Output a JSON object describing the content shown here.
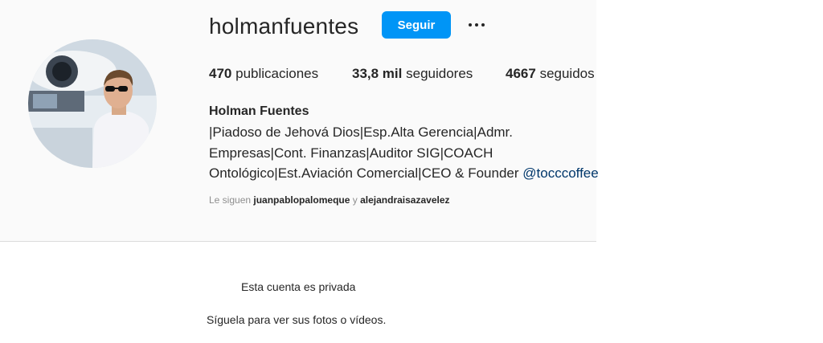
{
  "profile": {
    "username": "holmanfuentes",
    "follow_label": "Seguir",
    "more_icon": "more-horizontal-icon",
    "full_name": "Holman Fuentes",
    "bio_lines": [
      "|Piadoso de Jehová Dios|Esp.Alta Gerencia|Admr.",
      "Empresas|Cont. Finanzas|Auditor SIG|COACH",
      "Ontológico|Est.Aviación Comercial|CEO & Founder"
    ],
    "bio_mention": "@tocccoffee"
  },
  "stats": {
    "posts_count": "470",
    "posts_label": "publicaciones",
    "followers_count": "33,8 mil",
    "followers_label": "seguidores",
    "following_count": "4667",
    "following_label": "seguidos"
  },
  "followed_by": {
    "prefix": "Le siguen",
    "user1": "juanpablopalomeque",
    "conjunction": "y",
    "user2": "alejandraisazavelez"
  },
  "private_notice": {
    "title": "Esta cuenta es privada",
    "subtitle": "Síguela para ver sus fotos o vídeos."
  },
  "colors": {
    "accent": "#0095f6",
    "mention": "#00376b",
    "header_bg": "#fafafa"
  }
}
